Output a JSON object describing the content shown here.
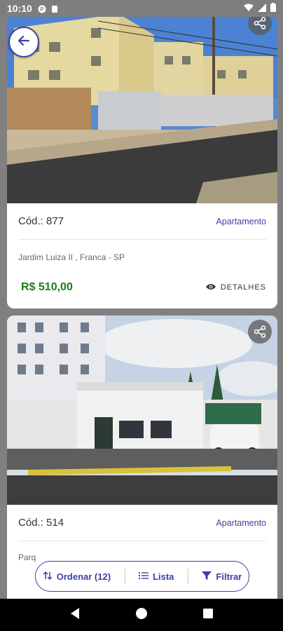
{
  "status_bar": {
    "time": "10:10"
  },
  "listings": [
    {
      "code": "Cód.: 877",
      "type": "Apartamento",
      "address": "Jardim Luiza II , Franca - SP",
      "price": "R$  510,00",
      "details_label": "DETALHES"
    },
    {
      "code": "Cód.: 514",
      "type": "Apartamento",
      "address_partial": "Parq"
    }
  ],
  "bottom_actions": {
    "sort_label": "Ordenar (12)",
    "list_label": "Lista",
    "filter_label": "Filtrar"
  },
  "colors": {
    "accent": "#3d3fa8",
    "price": "#1e7a1e"
  },
  "icons": [
    "back-arrow-icon",
    "share-icon",
    "eye-icon",
    "sort-icon",
    "list-icon",
    "filter-icon",
    "nav-back-icon",
    "nav-home-icon",
    "nav-recents-icon"
  ]
}
